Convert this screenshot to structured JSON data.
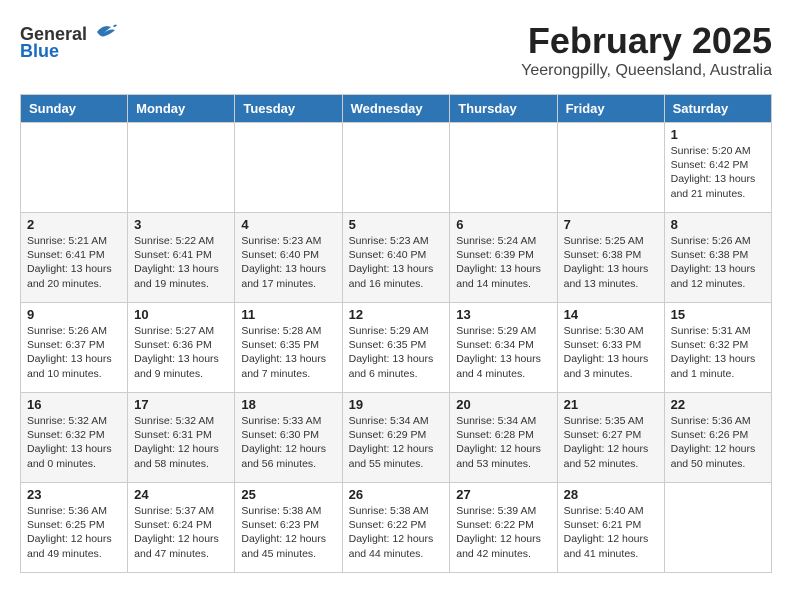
{
  "logo": {
    "general": "General",
    "blue": "Blue"
  },
  "header": {
    "title": "February 2025",
    "subtitle": "Yeerongpilly, Queensland, Australia"
  },
  "weekdays": [
    "Sunday",
    "Monday",
    "Tuesday",
    "Wednesday",
    "Thursday",
    "Friday",
    "Saturday"
  ],
  "weeks": [
    [
      {
        "day": "",
        "info": ""
      },
      {
        "day": "",
        "info": ""
      },
      {
        "day": "",
        "info": ""
      },
      {
        "day": "",
        "info": ""
      },
      {
        "day": "",
        "info": ""
      },
      {
        "day": "",
        "info": ""
      },
      {
        "day": "1",
        "info": "Sunrise: 5:20 AM\nSunset: 6:42 PM\nDaylight: 13 hours and 21 minutes."
      }
    ],
    [
      {
        "day": "2",
        "info": "Sunrise: 5:21 AM\nSunset: 6:41 PM\nDaylight: 13 hours and 20 minutes."
      },
      {
        "day": "3",
        "info": "Sunrise: 5:22 AM\nSunset: 6:41 PM\nDaylight: 13 hours and 19 minutes."
      },
      {
        "day": "4",
        "info": "Sunrise: 5:23 AM\nSunset: 6:40 PM\nDaylight: 13 hours and 17 minutes."
      },
      {
        "day": "5",
        "info": "Sunrise: 5:23 AM\nSunset: 6:40 PM\nDaylight: 13 hours and 16 minutes."
      },
      {
        "day": "6",
        "info": "Sunrise: 5:24 AM\nSunset: 6:39 PM\nDaylight: 13 hours and 14 minutes."
      },
      {
        "day": "7",
        "info": "Sunrise: 5:25 AM\nSunset: 6:38 PM\nDaylight: 13 hours and 13 minutes."
      },
      {
        "day": "8",
        "info": "Sunrise: 5:26 AM\nSunset: 6:38 PM\nDaylight: 13 hours and 12 minutes."
      }
    ],
    [
      {
        "day": "9",
        "info": "Sunrise: 5:26 AM\nSunset: 6:37 PM\nDaylight: 13 hours and 10 minutes."
      },
      {
        "day": "10",
        "info": "Sunrise: 5:27 AM\nSunset: 6:36 PM\nDaylight: 13 hours and 9 minutes."
      },
      {
        "day": "11",
        "info": "Sunrise: 5:28 AM\nSunset: 6:35 PM\nDaylight: 13 hours and 7 minutes."
      },
      {
        "day": "12",
        "info": "Sunrise: 5:29 AM\nSunset: 6:35 PM\nDaylight: 13 hours and 6 minutes."
      },
      {
        "day": "13",
        "info": "Sunrise: 5:29 AM\nSunset: 6:34 PM\nDaylight: 13 hours and 4 minutes."
      },
      {
        "day": "14",
        "info": "Sunrise: 5:30 AM\nSunset: 6:33 PM\nDaylight: 13 hours and 3 minutes."
      },
      {
        "day": "15",
        "info": "Sunrise: 5:31 AM\nSunset: 6:32 PM\nDaylight: 13 hours and 1 minute."
      }
    ],
    [
      {
        "day": "16",
        "info": "Sunrise: 5:32 AM\nSunset: 6:32 PM\nDaylight: 13 hours and 0 minutes."
      },
      {
        "day": "17",
        "info": "Sunrise: 5:32 AM\nSunset: 6:31 PM\nDaylight: 12 hours and 58 minutes."
      },
      {
        "day": "18",
        "info": "Sunrise: 5:33 AM\nSunset: 6:30 PM\nDaylight: 12 hours and 56 minutes."
      },
      {
        "day": "19",
        "info": "Sunrise: 5:34 AM\nSunset: 6:29 PM\nDaylight: 12 hours and 55 minutes."
      },
      {
        "day": "20",
        "info": "Sunrise: 5:34 AM\nSunset: 6:28 PM\nDaylight: 12 hours and 53 minutes."
      },
      {
        "day": "21",
        "info": "Sunrise: 5:35 AM\nSunset: 6:27 PM\nDaylight: 12 hours and 52 minutes."
      },
      {
        "day": "22",
        "info": "Sunrise: 5:36 AM\nSunset: 6:26 PM\nDaylight: 12 hours and 50 minutes."
      }
    ],
    [
      {
        "day": "23",
        "info": "Sunrise: 5:36 AM\nSunset: 6:25 PM\nDaylight: 12 hours and 49 minutes."
      },
      {
        "day": "24",
        "info": "Sunrise: 5:37 AM\nSunset: 6:24 PM\nDaylight: 12 hours and 47 minutes."
      },
      {
        "day": "25",
        "info": "Sunrise: 5:38 AM\nSunset: 6:23 PM\nDaylight: 12 hours and 45 minutes."
      },
      {
        "day": "26",
        "info": "Sunrise: 5:38 AM\nSunset: 6:22 PM\nDaylight: 12 hours and 44 minutes."
      },
      {
        "day": "27",
        "info": "Sunrise: 5:39 AM\nSunset: 6:22 PM\nDaylight: 12 hours and 42 minutes."
      },
      {
        "day": "28",
        "info": "Sunrise: 5:40 AM\nSunset: 6:21 PM\nDaylight: 12 hours and 41 minutes."
      },
      {
        "day": "",
        "info": ""
      }
    ]
  ]
}
